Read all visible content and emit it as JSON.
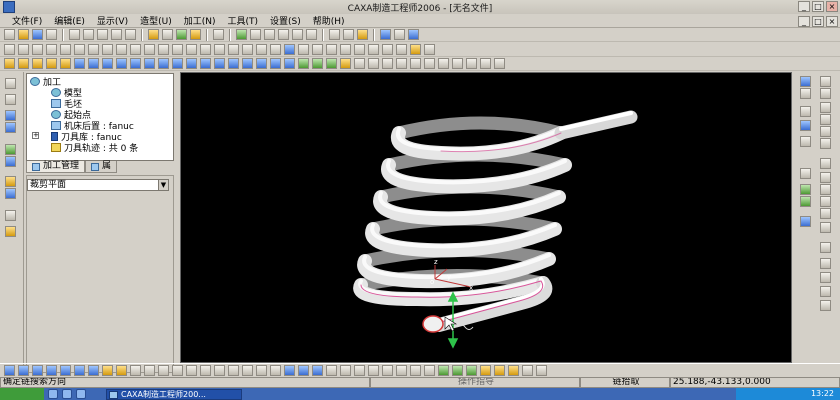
{
  "window": {
    "title": "CAXA制造工程师2006 - [无名文件]"
  },
  "menu": [
    "文件(F)",
    "编辑(E)",
    "显示(V)",
    "造型(U)",
    "加工(N)",
    "工具(T)",
    "设置(S)",
    "帮助(H)"
  ],
  "tree": {
    "items": [
      {
        "label": "加工",
        "icon": "machining-icon"
      },
      {
        "label": "模型",
        "icon": "model-icon"
      },
      {
        "label": "毛坯",
        "icon": "blank-icon"
      },
      {
        "label": "起始点",
        "icon": "start-point-icon"
      },
      {
        "label": "机床后置 : fanuc",
        "icon": "machine-post-icon"
      },
      {
        "label": "刀具库 : fanuc",
        "icon": "tool-library-icon"
      },
      {
        "label": "刀具轨迹 : 共 0 条",
        "icon": "toolpath-folder-icon"
      }
    ]
  },
  "tabs": {
    "machining": "加工管理",
    "attr": "属"
  },
  "property": {
    "selected": "裁剪平面"
  },
  "viewport": {
    "triad_labels": {
      "z": "z",
      "y": "y",
      "o": "o",
      "x": "x"
    }
  },
  "status": {
    "prompt": "确定链搜索方向",
    "middle": "操作指导",
    "mode": "链拾取",
    "coords": "25.188,-43.133,0.000"
  },
  "taskbar": {
    "task": "CAXA制造工程师200...",
    "time": "13:22"
  }
}
